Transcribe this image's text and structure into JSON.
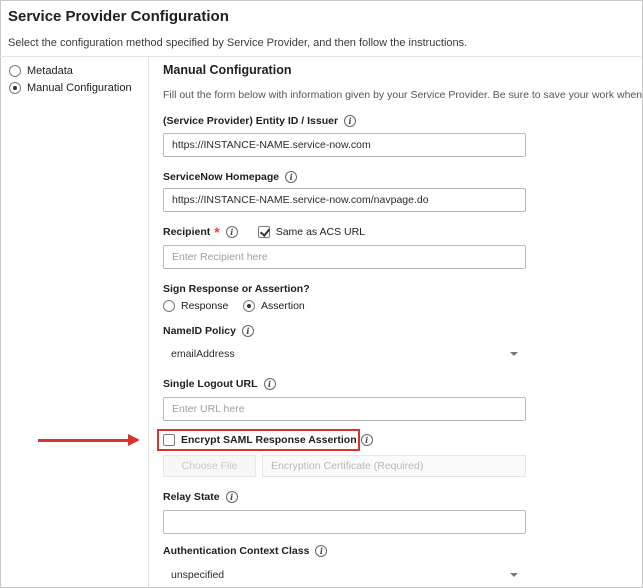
{
  "page": {
    "title": "Service Provider Configuration",
    "subtitle": "Select the configuration method specified by Service Provider, and then follow the instructions."
  },
  "method_options": [
    {
      "label": "Metadata",
      "selected": false
    },
    {
      "label": "Manual Configuration",
      "selected": true
    }
  ],
  "manual": {
    "title": "Manual Configuration",
    "description": "Fill out the form below with information given by your Service Provider. Be sure to save your work when done."
  },
  "fields": {
    "entity_id": {
      "label": "(Service Provider) Entity ID / Issuer",
      "value": "https://INSTANCE-NAME.service-now.com"
    },
    "homepage": {
      "label": "ServiceNow Homepage",
      "value": "https://INSTANCE-NAME.service-now.com/navpage.do"
    },
    "recipient": {
      "label": "Recipient",
      "required_mark": "*",
      "same_as_acs_label": "Same as ACS URL",
      "same_as_acs_checked": true,
      "placeholder": "Enter Recipient here"
    },
    "sign": {
      "label": "Sign Response or Assertion?",
      "options": [
        {
          "label": "Response",
          "selected": false
        },
        {
          "label": "Assertion",
          "selected": true
        }
      ]
    },
    "nameid": {
      "label": "NameID Policy",
      "value": "emailAddress"
    },
    "logout": {
      "label": "Single Logout URL",
      "placeholder": "Enter URL here"
    },
    "encrypt": {
      "label": "Encrypt SAML Response Assertion",
      "checked": false,
      "choose_file_label": "Choose File",
      "cert_placeholder": "Encryption Certificate (Required)"
    },
    "relay": {
      "label": "Relay State",
      "value": ""
    },
    "auth_context": {
      "label": "Authentication Context Class",
      "value": "unspecified"
    }
  },
  "colors": {
    "accent_red": "#d9342b",
    "required_star": "#e8452c"
  },
  "icons": {
    "info": "info-icon",
    "dropdown": "chevron-down-icon",
    "annotation": "arrow-right-icon"
  }
}
